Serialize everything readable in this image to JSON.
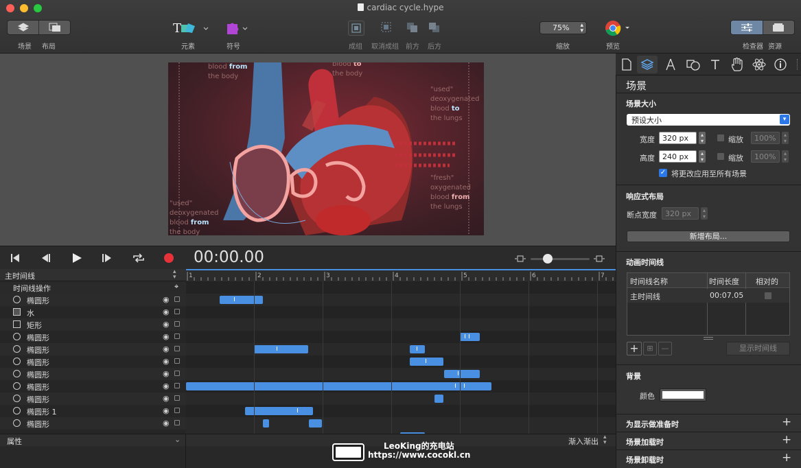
{
  "window": {
    "title": "cardiac cycle.hype"
  },
  "toolbar": {
    "scene_label": "场景",
    "layout_label": "布局",
    "elements_label": "元素",
    "symbols_label": "符号",
    "group_label": "成组",
    "ungroup_label": "取消成组",
    "front_label": "前方",
    "back_label": "后方",
    "zoom_value": "75%",
    "zoom_label": "缩放",
    "preview_label": "预览",
    "inspector_label": "检查器",
    "resources_label": "资源"
  },
  "stage_text": {
    "a1": "blood",
    "a2": "from",
    "a3": "the body",
    "b1": "blood",
    "b2": "to",
    "b3": "the body",
    "c1": "\"used\"",
    "c2": "deoxygenated",
    "c3": "blood",
    "c4": "to",
    "c5": "the lungs",
    "d1": "\"fresh\"",
    "d2": "oxygenated",
    "d3": "blood",
    "d4": "from",
    "d5": "the lungs",
    "e1": "\"used\"",
    "e2": "deoxygenated",
    "e3": "blood",
    "e4": "from",
    "e5": "the body"
  },
  "transport": {
    "timecode": "00:00.00"
  },
  "timeline": {
    "main_label": "主时间线",
    "actions_label": "时间线操作",
    "ruler": [
      "1",
      "2",
      "3",
      "4",
      "5",
      "6",
      "7"
    ],
    "layers": [
      {
        "name": "椭圆形",
        "icon": "circle"
      },
      {
        "name": "水",
        "icon": "image"
      },
      {
        "name": "矩形",
        "icon": "square"
      },
      {
        "name": "椭圆形",
        "icon": "circle"
      },
      {
        "name": "椭圆形",
        "icon": "circle"
      },
      {
        "name": "椭圆形",
        "icon": "circle"
      },
      {
        "name": "椭圆形",
        "icon": "circle"
      },
      {
        "name": "椭圆形",
        "icon": "circle"
      },
      {
        "name": "椭圆形",
        "icon": "circle"
      },
      {
        "name": "椭圆形 1",
        "icon": "circle"
      },
      {
        "name": "椭圆形",
        "icon": "circle"
      }
    ],
    "properties_label": "属性",
    "easing_label": "渐入渐出"
  },
  "watermark": {
    "line1": "LeoKing的充电站",
    "line2": "https://www.cocokl.cn"
  },
  "inspector": {
    "title": "场景",
    "scene_size_label": "场景大小",
    "preset_value": "预设大小",
    "width_label": "宽度",
    "width_value": "320 px",
    "height_label": "高度",
    "height_value": "240 px",
    "scale_label": "缩放",
    "scale_value_1": "100%",
    "scale_value_2": "100%",
    "apply_all_label": "将更改应用至所有场景",
    "responsive_label": "响应式布局",
    "breakpoint_label": "断点宽度",
    "breakpoint_value": "320 px",
    "new_layout_btn": "新增布局...",
    "anim_timelines_label": "动画时间线",
    "col_name": "时间线名称",
    "col_duration": "时间长度",
    "col_relative": "相对的",
    "row_name": "主时间线",
    "row_duration": "00:07.05",
    "show_timeline_btn": "显示时间线",
    "background_label": "背景",
    "color_label": "颜色",
    "on_prepare_label": "为显示做准备时",
    "on_load_label": "场景加载时",
    "on_unload_label": "场景卸载时"
  }
}
